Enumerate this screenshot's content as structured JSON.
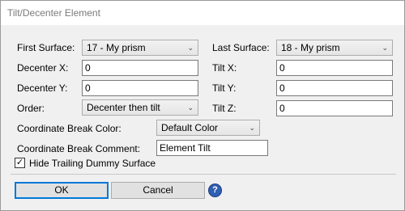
{
  "window": {
    "title": "Tilt/Decenter Element"
  },
  "fields": {
    "first_surface": {
      "label": "First Surface:",
      "value": "17 - My prism"
    },
    "last_surface": {
      "label": "Last Surface:",
      "value": "18 - My prism"
    },
    "decenter_x": {
      "label": "Decenter X:",
      "value": "0"
    },
    "decenter_y": {
      "label": "Decenter Y:",
      "value": "0"
    },
    "tilt_x": {
      "label": "Tilt X:",
      "value": "0"
    },
    "tilt_y": {
      "label": "Tilt Y:",
      "value": "0"
    },
    "tilt_z": {
      "label": "Tilt Z:",
      "value": "0"
    },
    "order": {
      "label": "Order:",
      "value": "Decenter then tilt"
    },
    "cb_color": {
      "label": "Coordinate Break Color:",
      "value": "Default Color"
    },
    "cb_comment": {
      "label": "Coordinate Break Comment:",
      "value": "Element Tilt"
    },
    "hide_dummy": {
      "label": "Hide Trailing Dummy Surface",
      "checked": true,
      "mark": "✓"
    }
  },
  "buttons": {
    "ok": "OK",
    "cancel": "Cancel",
    "help": "?"
  }
}
